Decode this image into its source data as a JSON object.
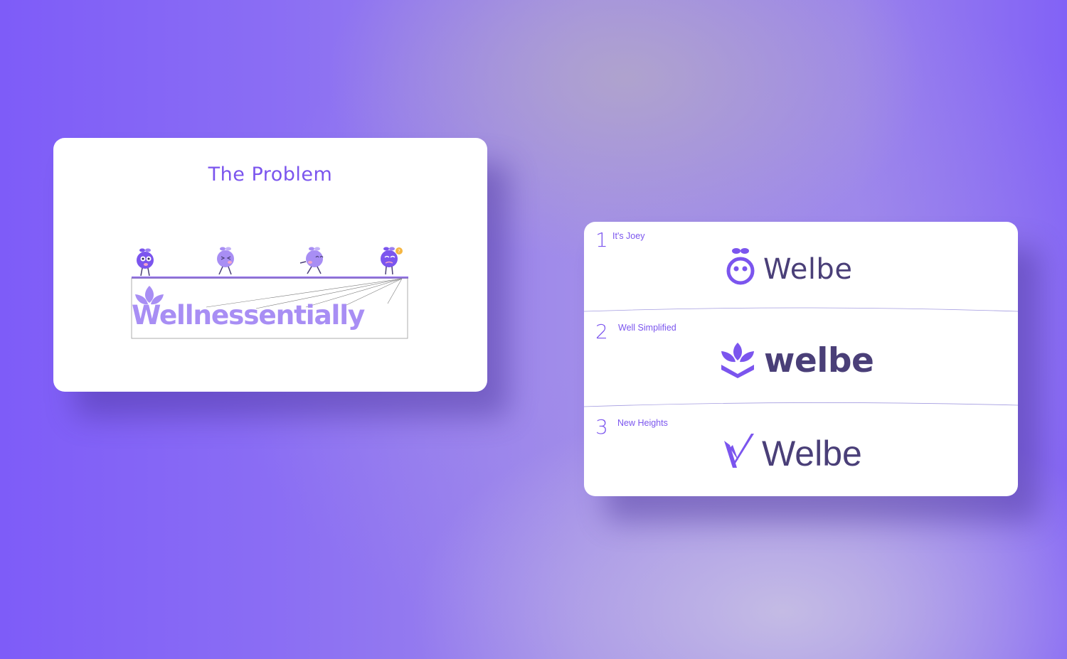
{
  "problem_card": {
    "title": "The Problem",
    "wordmark": "Wellnessentially"
  },
  "options": [
    {
      "number": "1",
      "name": "It's Joey",
      "logo_text": "Welbe",
      "mark_icon": "joey-face-icon"
    },
    {
      "number": "2",
      "name": "Well Simplified",
      "logo_text": "welbe",
      "mark_icon": "leaf-sprout-icon"
    },
    {
      "number": "3",
      "name": "New Heights",
      "logo_text": "Welbe",
      "mark_icon": "check-peak-icon"
    }
  ],
  "colors": {
    "brand_purple": "#7b55ee",
    "light_purple": "#a88ef4",
    "wordmark_dark": "#4a3f78",
    "background_start": "#7e5cf8"
  }
}
